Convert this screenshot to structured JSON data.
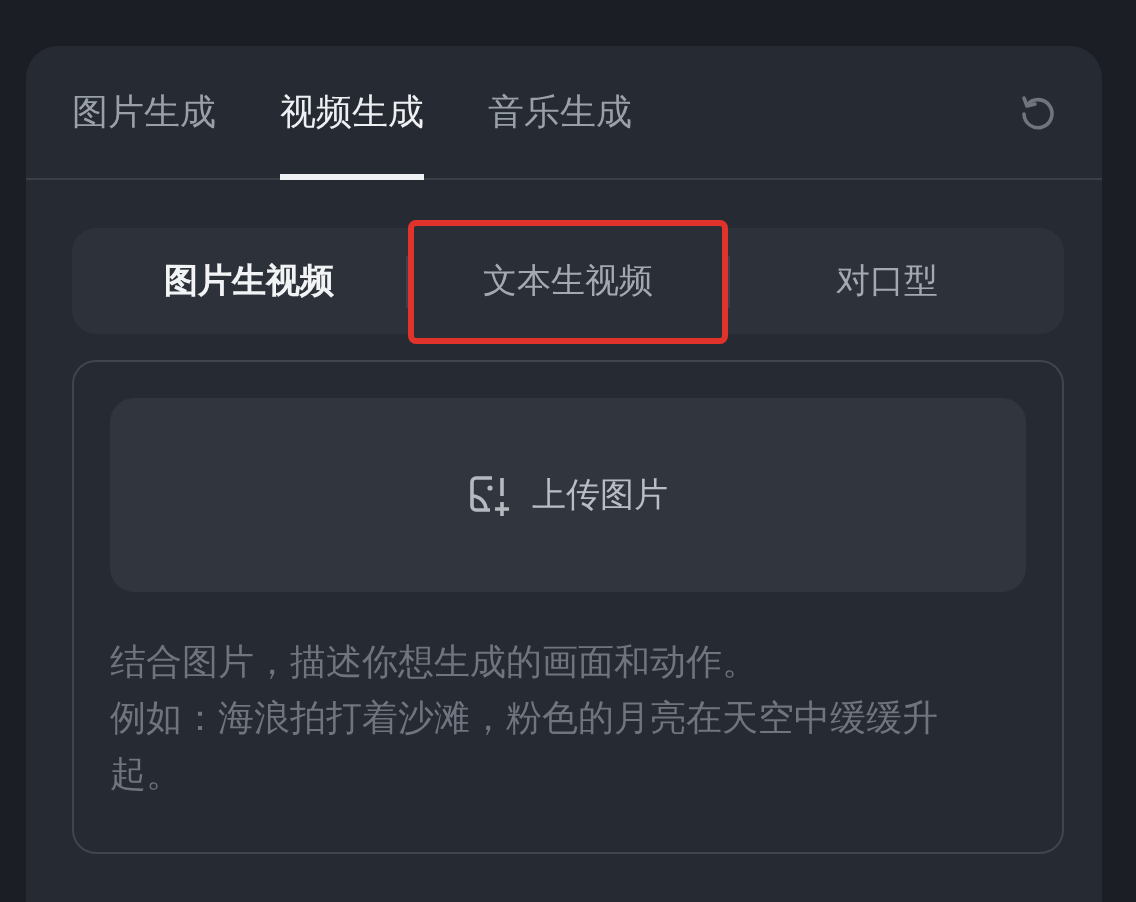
{
  "tabs": [
    {
      "label": "图片生成",
      "selected": false
    },
    {
      "label": "视频生成",
      "selected": true
    },
    {
      "label": "音乐生成",
      "selected": false
    }
  ],
  "modes": [
    {
      "label": "图片生视频",
      "selected": true,
      "highlighted": false
    },
    {
      "label": "文本生视频",
      "selected": false,
      "highlighted": true
    },
    {
      "label": "对口型",
      "selected": false,
      "highlighted": false
    }
  ],
  "upload": {
    "label": "上传图片"
  },
  "prompt": {
    "placeholder": [
      "结合图片，描述你想生成的画面和动作。",
      "例如：海浪拍打着沙滩，粉色的月亮在天空中缓缓升起。"
    ]
  }
}
